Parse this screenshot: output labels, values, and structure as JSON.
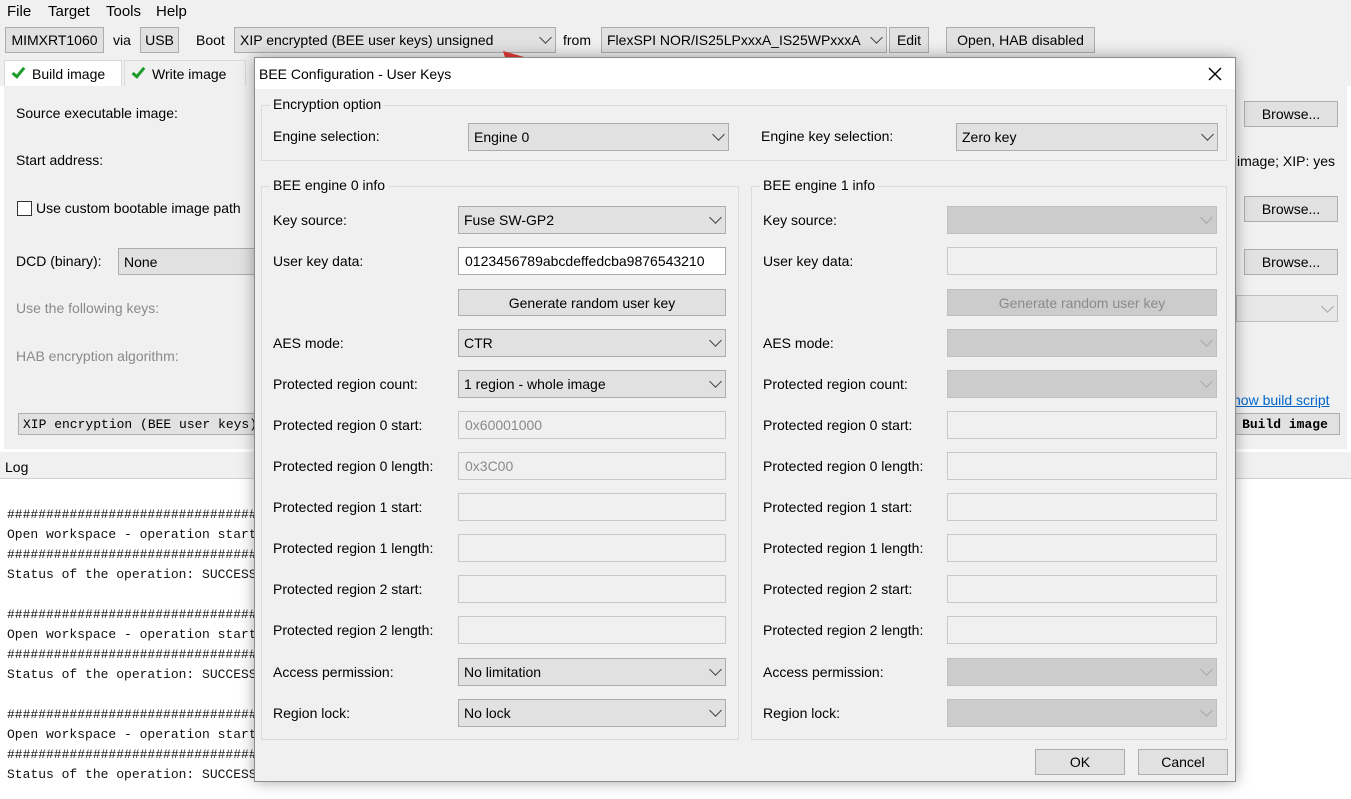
{
  "menu": [
    "File",
    "Target",
    "Tools",
    "Help"
  ],
  "toolbar": {
    "device": "MIMXRT1060",
    "via_label": "via",
    "interface": "USB",
    "boot_label": "Boot",
    "boot_mode": "XIP encrypted (BEE user keys) unsigned",
    "from_label": "from",
    "flash_device": "FlexSPI NOR/IS25LPxxxA_IS25WPxxxA",
    "edit_label": "Edit",
    "lifecycle": "Open, HAB disabled"
  },
  "tabs": [
    {
      "label": "Build image",
      "active": true
    },
    {
      "label": "Write image",
      "active": false
    }
  ],
  "build_panel": {
    "source_label": "Source executable image:",
    "start_label": "Start address:",
    "custom_image_label": "Use custom bootable image path",
    "dcd_label": "DCD (binary):",
    "dcd_value": "None",
    "keys_label": "Use the following keys:",
    "hab_label": "HAB encryption algorithm:",
    "xip_button": "XIP encryption (BEE user keys)",
    "browse1": "Browse...",
    "browse2": "Browse...",
    "browse3": "Browse...",
    "image_info": "image; XIP: yes",
    "show_script": "how build script",
    "build_button": "Build image"
  },
  "log": {
    "title": "Log",
    "lines": [
      "################################",
      "Open workspace - operation starte",
      "################################",
      "Status of the operation: SUCCESS",
      "",
      "################################",
      "Open workspace - operation starte",
      "################################",
      "Status of the operation: SUCCESS",
      "",
      "################################",
      "Open workspace - operation starte",
      "################################",
      "Status of the operation: SUCCESS"
    ]
  },
  "dialog": {
    "title": "BEE Configuration - User Keys",
    "encryption_group": "Encryption option",
    "engine_sel_label": "Engine selection:",
    "engine_sel_value": "Engine 0",
    "engine_key_label": "Engine key selection:",
    "engine_key_value": "Zero key",
    "engine0": {
      "title": "BEE engine 0 info",
      "key_source_label": "Key source:",
      "key_source_value": "Fuse SW-GP2",
      "user_key_label": "User key data:",
      "user_key_value": "0123456789abcdeffedcba9876543210",
      "generate_label": "Generate random user key",
      "aes_label": "AES mode:",
      "aes_value": "CTR",
      "region_count_label": "Protected region count:",
      "region_count_value": "1 region - whole image",
      "r0_start_label": "Protected region 0 start:",
      "r0_start_value": "0x60001000",
      "r0_len_label": "Protected region 0 length:",
      "r0_len_value": "0x3C00",
      "r1_start_label": "Protected region 1 start:",
      "r1_len_label": "Protected region 1 length:",
      "r2_start_label": "Protected region 2 start:",
      "r2_len_label": "Protected region 2 length:",
      "access_label": "Access permission:",
      "access_value": "No limitation",
      "lock_label": "Region lock:",
      "lock_value": "No lock"
    },
    "engine1": {
      "title": "BEE engine 1 info",
      "key_source_label": "Key source:",
      "user_key_label": "User key data:",
      "generate_label": "Generate random user key",
      "aes_label": "AES mode:",
      "region_count_label": "Protected region count:",
      "r0_start_label": "Protected region 0 start:",
      "r0_len_label": "Protected region 0 length:",
      "r1_start_label": "Protected region 1 start:",
      "r1_len_label": "Protected region 1 length:",
      "r2_start_label": "Protected region 2 start:",
      "r2_len_label": "Protected region 2 length:",
      "access_label": "Access permission:",
      "lock_label": "Region lock:"
    },
    "ok_label": "OK",
    "cancel_label": "Cancel"
  },
  "colors": {
    "annotation_arrow": "#e53935",
    "link": "#0066cc",
    "check": "#1c9c2a"
  }
}
